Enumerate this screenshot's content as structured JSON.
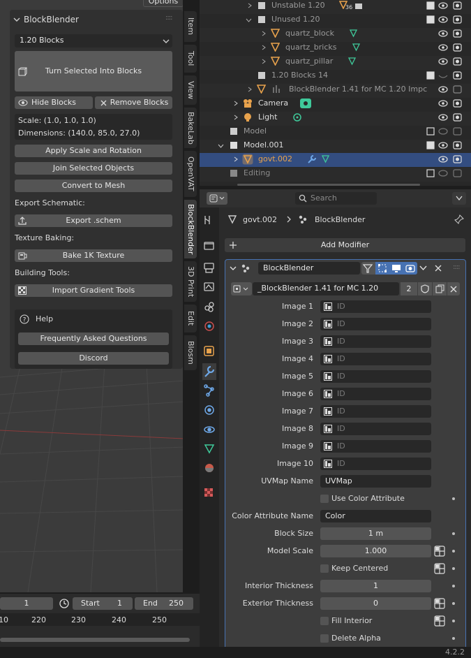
{
  "options_label": "Options",
  "left": {
    "panel_title": "BlockBlender",
    "dropdown_value": "1.20 Blocks",
    "turn_button": "Turn Selected Into Blocks",
    "hide_button": "Hide Blocks",
    "remove_button": "Remove Blocks",
    "scale_text": "Scale: (1.0, 1.0, 1.0)",
    "dimensions_text": "Dimensions: (140.0, 85.0, 27.0)",
    "apply_button": "Apply Scale and Rotation",
    "join_button": "Join Selected Objects",
    "convert_button": "Convert to Mesh",
    "export_label": "Export Schematic:",
    "export_button": "Export .schem",
    "texture_label": "Texture Baking:",
    "bake_button": "Bake 1K Texture",
    "building_label": "Building Tools:",
    "gradient_button": "Import Gradient Tools",
    "help_title": "Help",
    "faq_button": "Frequently Asked Questions",
    "discord_button": "Discord"
  },
  "side_tabs": [
    "Item",
    "Tool",
    "View",
    "BakeLab",
    "OpenVAT",
    "BlockBlender",
    "3D Print",
    "Edit",
    "Blosm"
  ],
  "timeline": {
    "current_frame": "1",
    "start_label": "Start",
    "start_value": "1",
    "end_label": "End",
    "end_value": "250",
    "ticks": [
      "10",
      "220",
      "230",
      "240",
      "250"
    ]
  },
  "outliner": {
    "rows": [
      {
        "label": "Unstable 1.20",
        "badge": "36"
      },
      {
        "label": "Unused 1.20"
      },
      {
        "label": "quartz_block"
      },
      {
        "label": "quartz_bricks"
      },
      {
        "label": "quartz_pillar"
      },
      {
        "label": "1.20 Blocks 14"
      },
      {
        "label": "BlockBlender 1.41 for MC 1.20 Impc"
      },
      {
        "label": "Camera"
      },
      {
        "label": "Light"
      },
      {
        "label": "Model"
      },
      {
        "label": "Model.001"
      },
      {
        "label": "govt.002"
      },
      {
        "label": "Editing"
      }
    ]
  },
  "properties": {
    "search_placeholder": "Search",
    "breadcrumb_object": "govt.002",
    "breadcrumb_modifier": "BlockBlender",
    "add_modifier": "Add Modifier",
    "modifier_name": "BlockBlender",
    "nodegroup_name": "_BlockBlender 1.41 for MC 1.20",
    "nodegroup_users": "2",
    "images": [
      {
        "label": "Image 1",
        "placeholder": "ID"
      },
      {
        "label": "Image 2",
        "placeholder": "ID"
      },
      {
        "label": "Image 3",
        "placeholder": "ID"
      },
      {
        "label": "Image 4",
        "placeholder": "ID"
      },
      {
        "label": "Image 5",
        "placeholder": "ID"
      },
      {
        "label": "Image 6",
        "placeholder": "ID"
      },
      {
        "label": "Image 7",
        "placeholder": "ID"
      },
      {
        "label": "Image 8",
        "placeholder": "ID"
      },
      {
        "label": "Image 9",
        "placeholder": "ID"
      },
      {
        "label": "Image 10",
        "placeholder": "ID"
      }
    ],
    "uvmap_label": "UVMap Name",
    "uvmap_value": "UVMap",
    "use_color_label": "Use Color Attribute",
    "color_attr_label": "Color Attribute Name",
    "color_attr_value": "Color",
    "block_size_label": "Block Size",
    "block_size_value": "1 m",
    "model_scale_label": "Model Scale",
    "model_scale_value": "1.000",
    "keep_centered_label": "Keep Centered",
    "interior_label": "Interior Thickness",
    "interior_value": "1",
    "exterior_label": "Exterior Thickness",
    "exterior_value": "0",
    "fill_interior_label": "Fill Interior",
    "delete_alpha_label": "Delete Alpha"
  },
  "version": "4.2.2",
  "colors": {
    "accent": "#4772b3",
    "orange": "#e8a24c",
    "green": "#3fc99a"
  }
}
